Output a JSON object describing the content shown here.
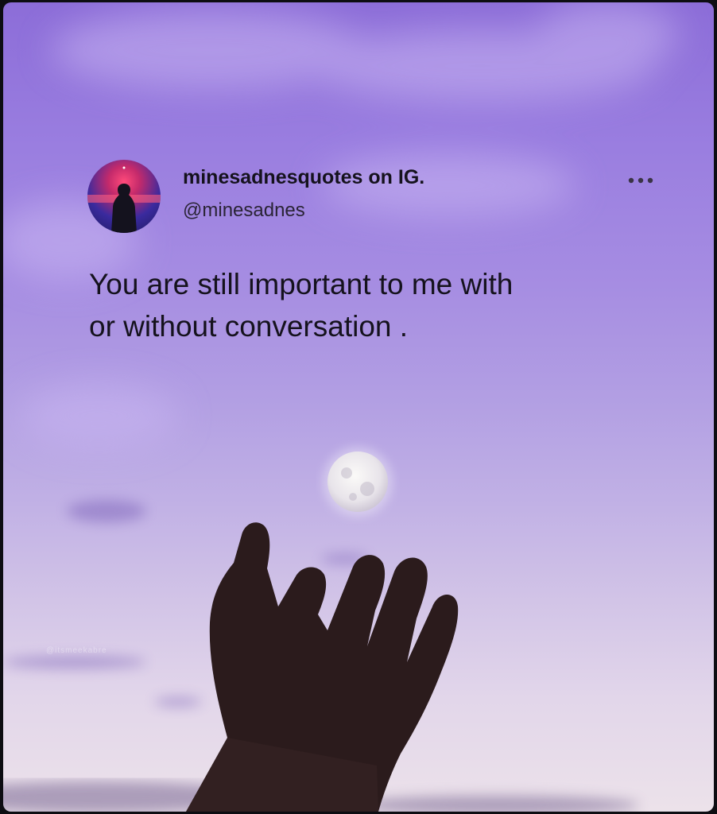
{
  "post": {
    "account_name": "minesadnesquotes on IG.",
    "handle": "@minesadnes",
    "quote_line_1": "You are still important to me with",
    "quote_line_2": "or without conversation ."
  },
  "watermark": "@itsmeekabre",
  "icons": {
    "more": "more-horizontal-icon",
    "avatar": "avatar-silhouette-icon"
  },
  "colors": {
    "sky_top": "#8c6dd8",
    "sky_bottom": "#ece2ea",
    "text": "#15121d",
    "hand": "#2a1a1a",
    "moon": "#f1eef2"
  }
}
